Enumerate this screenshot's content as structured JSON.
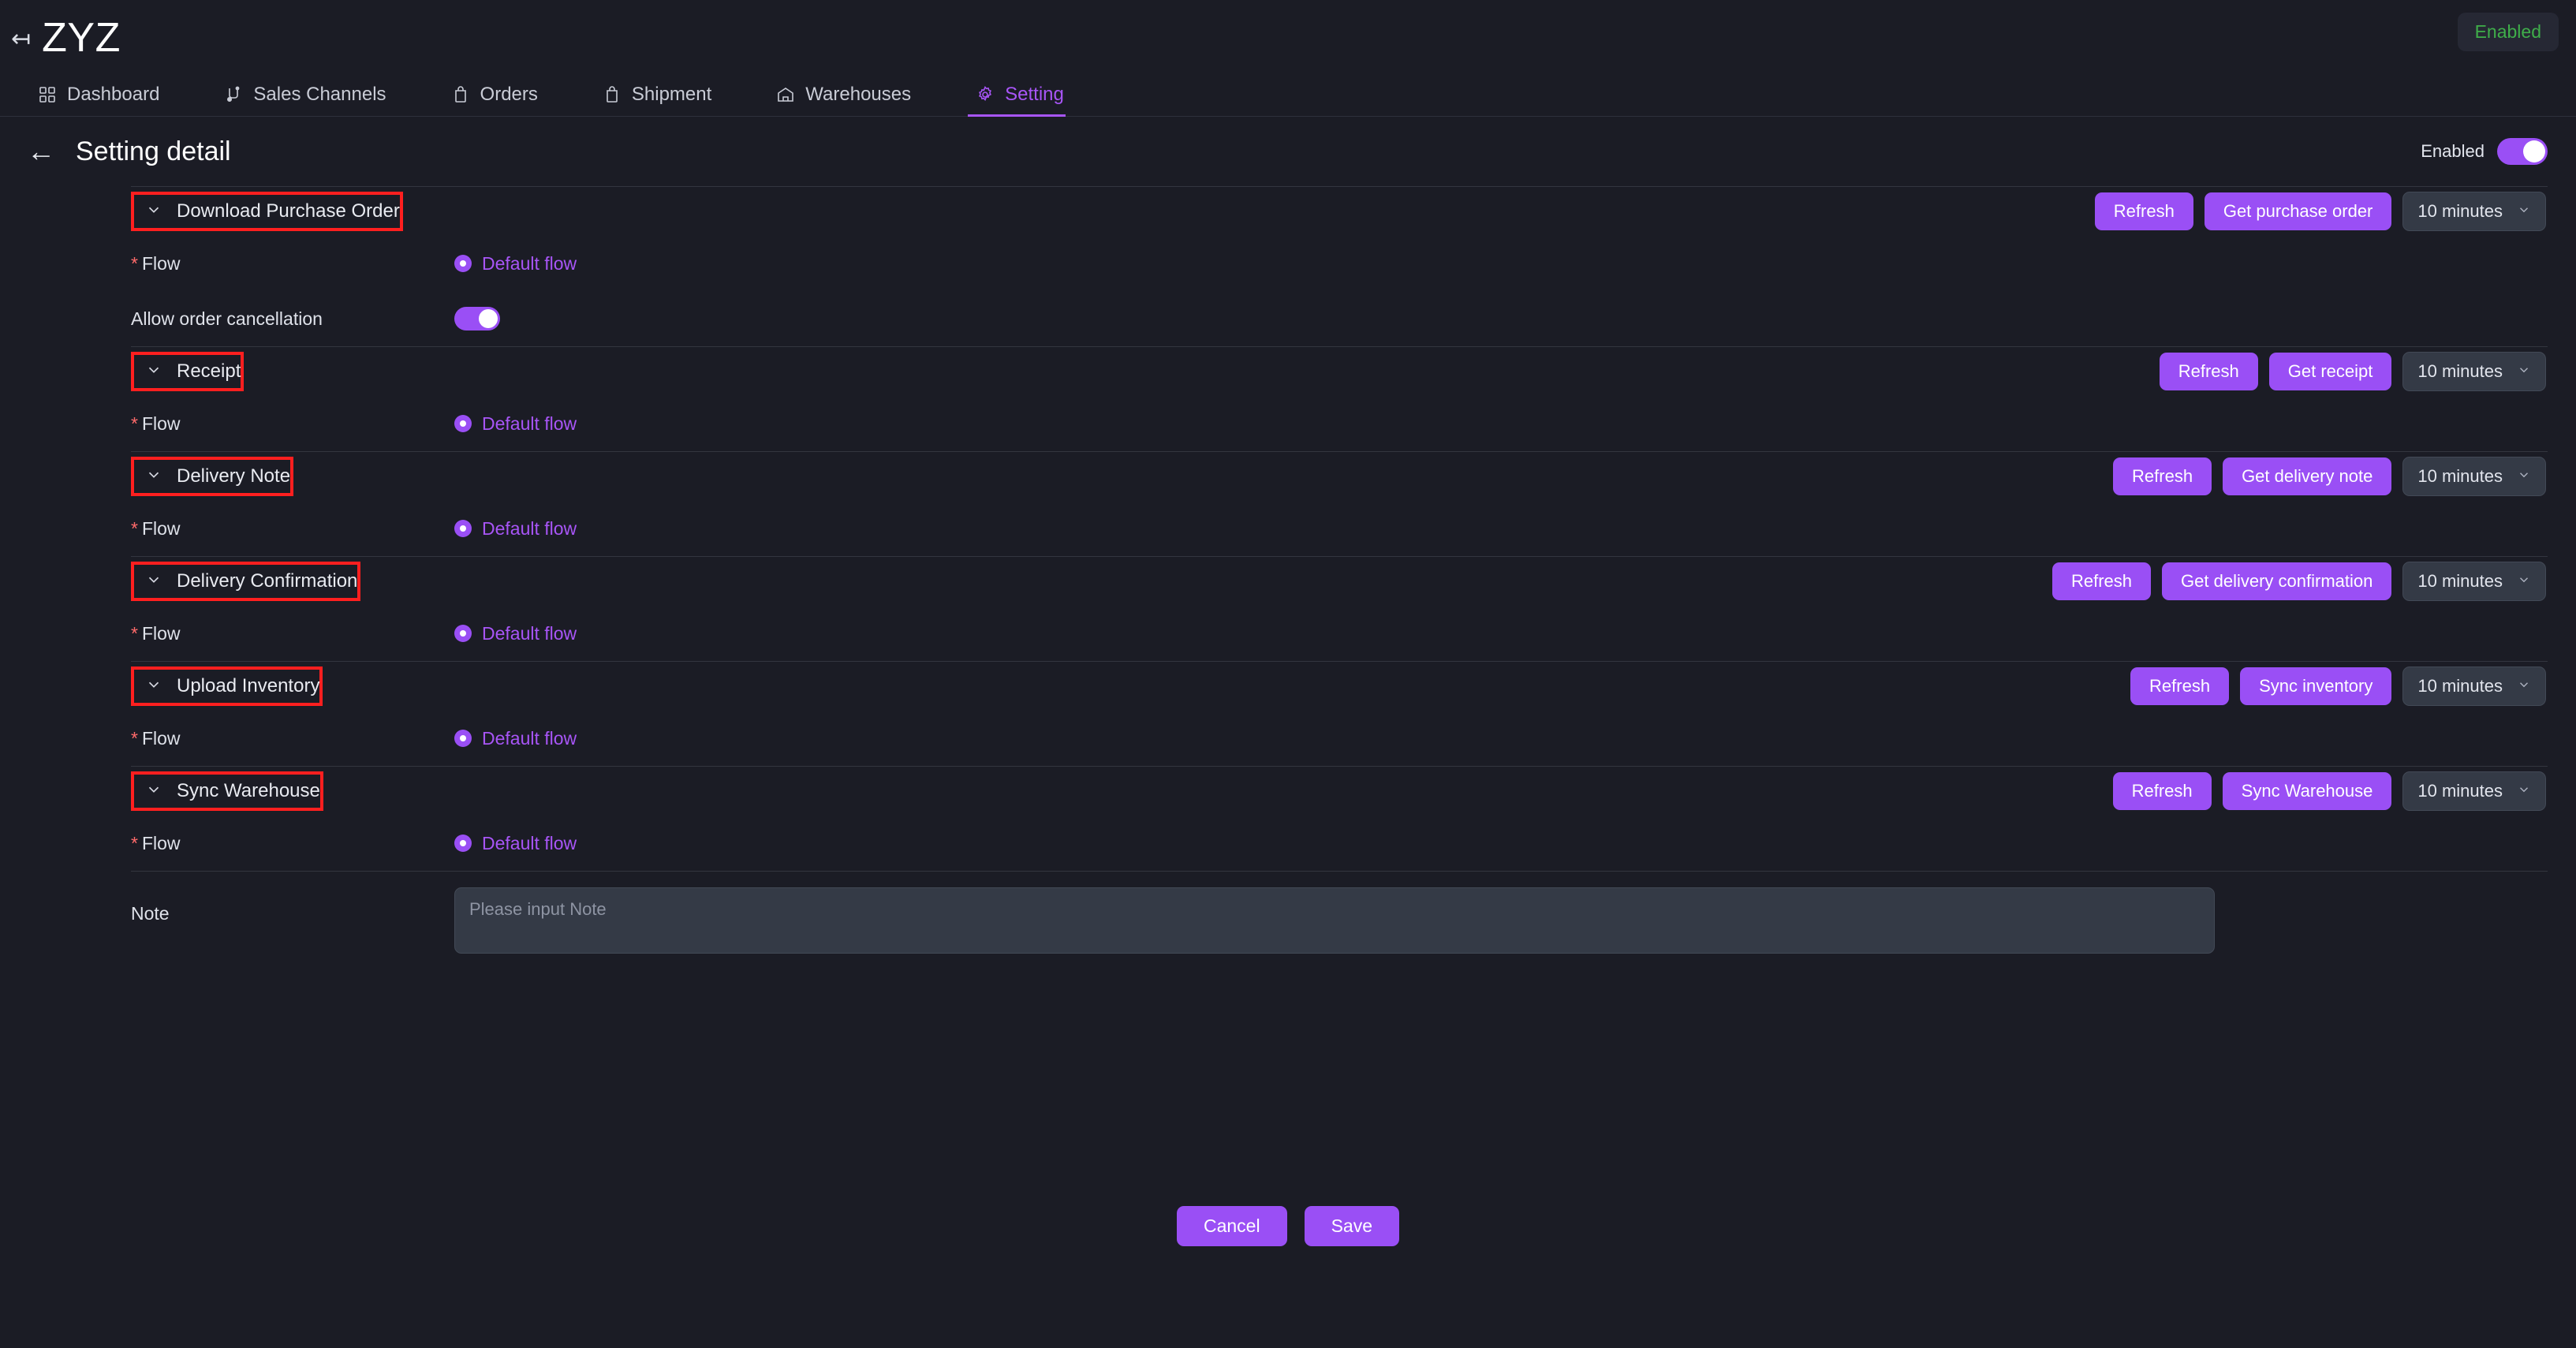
{
  "app": {
    "brand": "ZYZ",
    "status_badge": "Enabled"
  },
  "nav": {
    "tabs": [
      {
        "label": "Dashboard",
        "icon": "grid-icon",
        "active": false
      },
      {
        "label": "Sales Channels",
        "icon": "channels-icon",
        "active": false
      },
      {
        "label": "Orders",
        "icon": "bag-icon",
        "active": false
      },
      {
        "label": "Shipment",
        "icon": "bag-icon",
        "active": false
      },
      {
        "label": "Warehouses",
        "icon": "warehouse-icon",
        "active": false
      },
      {
        "label": "Setting",
        "icon": "gear-icon",
        "active": true
      }
    ]
  },
  "page": {
    "title": "Setting detail",
    "back_icon": "arrow-left-icon",
    "enabled_label": "Enabled",
    "enabled_value": true
  },
  "sections": [
    {
      "title": "Download Purchase Order",
      "chevron": "chevron-down-icon",
      "refresh_label": "Refresh",
      "action_label": "Get purchase order",
      "interval": "10 minutes",
      "fields": [
        {
          "type": "radio",
          "label": "Flow",
          "required": true,
          "option": "Default flow",
          "selected": true
        },
        {
          "type": "toggle",
          "label": "Allow order cancellation",
          "required": false,
          "value": true
        }
      ]
    },
    {
      "title": "Receipt",
      "chevron": "chevron-down-icon",
      "refresh_label": "Refresh",
      "action_label": "Get receipt",
      "interval": "10 minutes",
      "fields": [
        {
          "type": "radio",
          "label": "Flow",
          "required": true,
          "option": "Default flow",
          "selected": true
        }
      ]
    },
    {
      "title": "Delivery Note",
      "chevron": "chevron-down-icon",
      "refresh_label": "Refresh",
      "action_label": "Get delivery note",
      "interval": "10 minutes",
      "fields": [
        {
          "type": "radio",
          "label": "Flow",
          "required": true,
          "option": "Default flow",
          "selected": true
        }
      ]
    },
    {
      "title": "Delivery Confirmation",
      "chevron": "chevron-down-icon",
      "refresh_label": "Refresh",
      "action_label": "Get delivery confirmation",
      "interval": "10 minutes",
      "fields": [
        {
          "type": "radio",
          "label": "Flow",
          "required": true,
          "option": "Default flow",
          "selected": true
        }
      ]
    },
    {
      "title": "Upload Inventory",
      "chevron": "chevron-down-icon",
      "refresh_label": "Refresh",
      "action_label": "Sync inventory",
      "interval": "10 minutes",
      "fields": [
        {
          "type": "radio",
          "label": "Flow",
          "required": true,
          "option": "Default flow",
          "selected": true
        }
      ]
    },
    {
      "title": "Sync Warehouse",
      "chevron": "chevron-down-icon",
      "refresh_label": "Refresh",
      "action_label": "Sync Warehouse",
      "interval": "10 minutes",
      "fields": [
        {
          "type": "radio",
          "label": "Flow",
          "required": true,
          "option": "Default flow",
          "selected": true
        }
      ]
    }
  ],
  "note": {
    "label": "Note",
    "value": "",
    "placeholder": "Please input Note"
  },
  "footer": {
    "cancel_label": "Cancel",
    "save_label": "Save"
  },
  "colors": {
    "accent": "#9a4ff5",
    "accent_text": "#a855f7",
    "background": "#1b1c25",
    "annotation": "#ff1f1f",
    "status_green": "#3fae4a",
    "required_red": "#ff6a6a",
    "input_bg": "#343a46"
  }
}
